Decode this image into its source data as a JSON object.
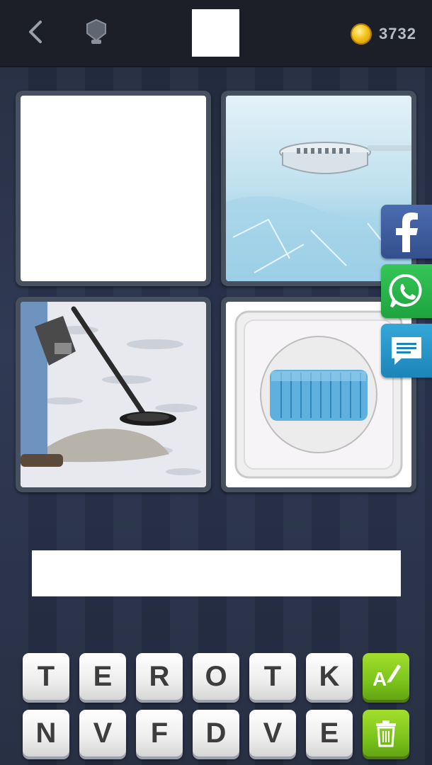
{
  "header": {
    "back_icon": "chevron-left-icon",
    "level_icon": "shield-icon",
    "coin_icon": "gold-coin-icon",
    "coins": "3732"
  },
  "tiles": [
    {
      "id": 1,
      "image": "blank"
    },
    {
      "id": 2,
      "image": "smoke-detector"
    },
    {
      "id": 3,
      "image": "metal-detector-on-sand"
    },
    {
      "id": 4,
      "image": "motion-sensor"
    }
  ],
  "share": {
    "facebook_icon": "facebook-icon",
    "whatsapp_icon": "whatsapp-icon",
    "message_icon": "message-icon"
  },
  "keyboard": {
    "row1": [
      "T",
      "E",
      "R",
      "O",
      "T",
      "K"
    ],
    "row2": [
      "N",
      "V",
      "F",
      "D",
      "V",
      "E"
    ],
    "reveal_letter_icon": "reveal-letter-icon",
    "remove_letters_icon": "trash-icon"
  },
  "colors": {
    "header_bg": "#1c1f28",
    "background": "#2b3550",
    "coin": "#f5c41a",
    "hint_green": "#7cc41c",
    "facebook": "#3b5998",
    "whatsapp": "#25c14f",
    "message": "#2196d3"
  }
}
